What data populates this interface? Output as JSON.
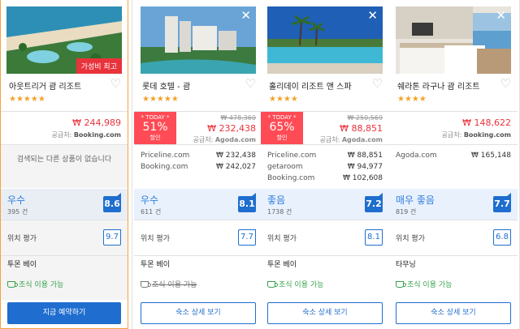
{
  "hotels": [
    {
      "name": "아웃트리거 괌 리조트",
      "badge": "가성비 최고",
      "stars": "★★★★★",
      "price": "₩ 244,989",
      "supplier_label": "공급처:",
      "supplier": "Booking.com",
      "offers_empty": "검색되는 다른 상품이 없습니다",
      "rating_word": "우수",
      "review_count": "395 건",
      "score": "8.6",
      "location_label": "위치 평가",
      "location_score": "9.7",
      "area": "투몬 베이",
      "breakfast": "조식 이용 가능",
      "button": "지금 예약하기"
    },
    {
      "name": "롯데 호텔 - 괌",
      "close": "✕",
      "stars": "★★★★★",
      "today": "* TODAY *",
      "discount_pct": "51%",
      "discount_label": "할인",
      "original_price": "₩ 478,360",
      "price": "₩ 232,438",
      "supplier_label": "공급처:",
      "supplier": "Agoda.com",
      "offers": [
        {
          "site": "Priceline.com",
          "price": "₩ 232,438"
        },
        {
          "site": "Booking.com",
          "price": "₩ 242,027"
        }
      ],
      "rating_word": "우수",
      "review_count": "611 건",
      "score": "8.1",
      "location_label": "위치 평가",
      "location_score": "7.7",
      "area": "투몬 베이",
      "breakfast": "조식 이용 가능",
      "button": "숙소 상세 보기"
    },
    {
      "name": "홀리데이 리조트 앤 스파",
      "close": "✕",
      "stars": "★★★★",
      "today": "* TODAY *",
      "discount_pct": "65%",
      "discount_label": "할인",
      "original_price": "₩ 250,569",
      "price": "₩ 88,851",
      "supplier_label": "공급처:",
      "supplier": "Agoda.com",
      "offers": [
        {
          "site": "Priceline.com",
          "price": "₩ 88,851"
        },
        {
          "site": "getaroom",
          "price": "₩ 94,977"
        },
        {
          "site": "Booking.com",
          "price": "₩ 102,608"
        }
      ],
      "rating_word": "좋음",
      "review_count": "1738 건",
      "score": "7.2",
      "location_label": "위치 평가",
      "location_score": "8.1",
      "area": "투몬 베이",
      "breakfast": "조식 이용 가능",
      "button": "숙소 상세 보기"
    },
    {
      "name": "쉐라톤 라구나 괌 리조트",
      "close": "✕",
      "stars": "★★★★",
      "price": "₩ 148,622",
      "supplier_label": "공급처:",
      "supplier": "Booking.com",
      "offers": [
        {
          "site": "Agoda.com",
          "price": "₩ 165,148"
        }
      ],
      "rating_word": "매우 좋음",
      "review_count": "819 건",
      "score": "7.7",
      "location_label": "위치 평가",
      "location_score": "6.8",
      "area": "타무닝",
      "breakfast": "조식 이용 가능",
      "button": "숙소 상세 보기"
    }
  ],
  "colors": {
    "accent": "#1f6ecf",
    "price_red": "#e8333b",
    "promo_red": "#ff4b55",
    "star": "#f3a22b",
    "breakfast_green": "#36a24a",
    "highlight_border": "#f7a23c"
  }
}
